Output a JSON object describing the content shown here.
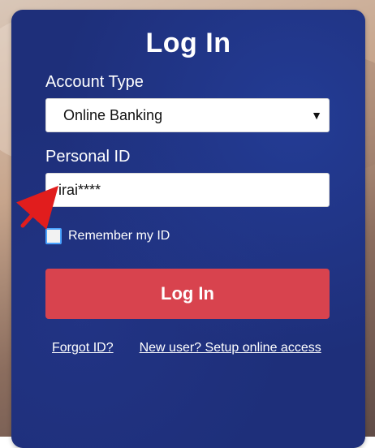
{
  "title": "Log In",
  "account_type": {
    "label": "Account Type",
    "selected": "Online Banking",
    "arrow_icon": "caret-down-icon"
  },
  "personal_id": {
    "label": "Personal ID",
    "value": "irai****"
  },
  "remember": {
    "label": "Remember my ID",
    "checked": false
  },
  "actions": {
    "login_label": "Log In",
    "forgot_link": "Forgot ID?",
    "new_user_link": "New user? Setup online access"
  },
  "colors": {
    "panel": "#1e2f7a",
    "primary_button": "#d8434e",
    "annotation_arrow": "#e11d1d"
  }
}
